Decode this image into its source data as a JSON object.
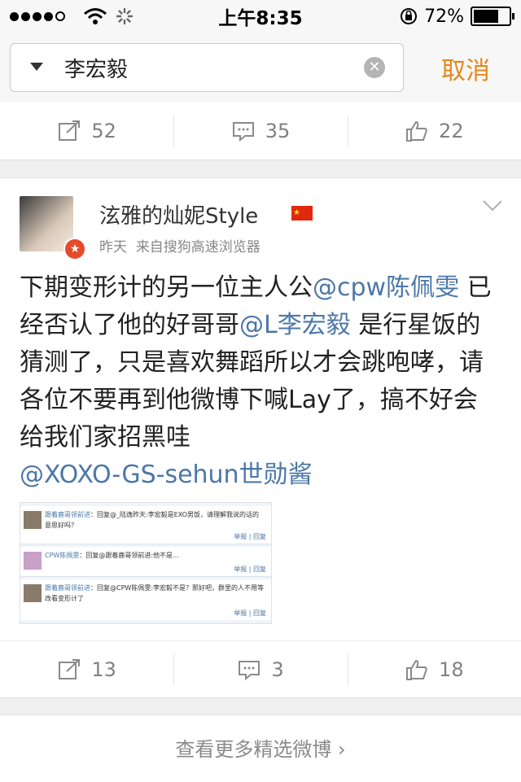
{
  "status_bar": {
    "time": "上午8:35",
    "battery": "72%",
    "battery_level": 0.72,
    "signal_bars_filled": 4,
    "signal_bars_total": 5
  },
  "search": {
    "query": "李宏毅",
    "cancel_label": "取消"
  },
  "prev_post": {
    "repost_count": "52",
    "comment_count": "35",
    "like_count": "22"
  },
  "post": {
    "username": "泫雅的灿妮Style",
    "time": "昨天",
    "source": "来自搜狗高速浏览器",
    "text_1": "下期变形计的另一位主人公",
    "mention_1": "@cpw陈佩雯",
    "text_2": " 已经否认了他的好哥哥",
    "mention_2": "@L李宏毅",
    "text_3": " 是行星饭的猜测了，只是喜欢舞蹈所以才会跳咆哮，请各位不要再到他微博下喊Lay了，搞不好会给我们家招黑哇",
    "mention_3": "@XOXO-GS-sehun世勋酱",
    "embedded_comments": [
      {
        "user": "跟着鹿哥领前进",
        "text": "：回复@_陆逸昨天:李宏毅是EXO男饭，请理解我说的话的意思好吗？",
        "links": "举报 | 回复"
      },
      {
        "user": "CPW陈佩雯",
        "text": "：回复@跟着鹿哥领前进:他不是...",
        "links": "举报 | 回复"
      },
      {
        "user": "跟着鹿哥领前进",
        "text": "：回复@CPW陈佩雯:李宏毅不是？那好吧，群里的人不用等改看变形计了",
        "links": "举报 | 回复"
      }
    ],
    "repost_count": "13",
    "comment_count": "3",
    "like_count": "18"
  },
  "footer": {
    "more_label": "查看更多精选微博 ›"
  },
  "colors": {
    "accent": "#e8861a",
    "mention": "#4b77a8",
    "flag_red": "#de2910"
  }
}
